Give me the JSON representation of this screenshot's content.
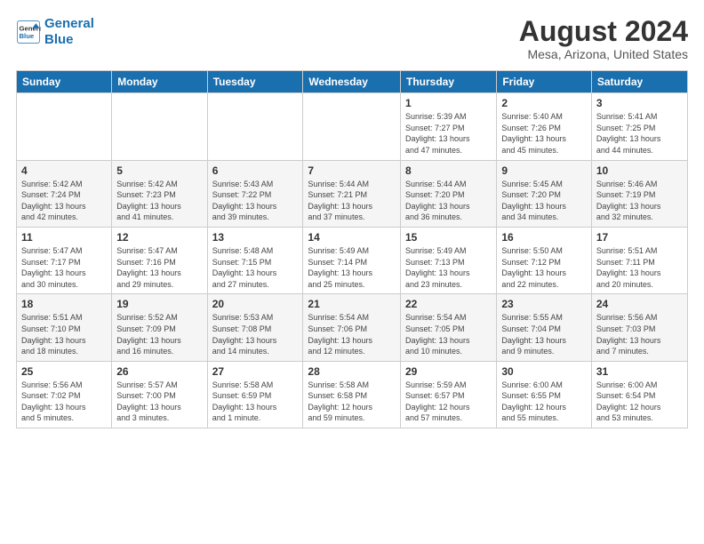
{
  "logo": {
    "line1": "General",
    "line2": "Blue"
  },
  "title": "August 2024",
  "subtitle": "Mesa, Arizona, United States",
  "days_header": [
    "Sunday",
    "Monday",
    "Tuesday",
    "Wednesday",
    "Thursday",
    "Friday",
    "Saturday"
  ],
  "weeks": [
    [
      {
        "day": "",
        "info": ""
      },
      {
        "day": "",
        "info": ""
      },
      {
        "day": "",
        "info": ""
      },
      {
        "day": "",
        "info": ""
      },
      {
        "day": "1",
        "info": "Sunrise: 5:39 AM\nSunset: 7:27 PM\nDaylight: 13 hours\nand 47 minutes."
      },
      {
        "day": "2",
        "info": "Sunrise: 5:40 AM\nSunset: 7:26 PM\nDaylight: 13 hours\nand 45 minutes."
      },
      {
        "day": "3",
        "info": "Sunrise: 5:41 AM\nSunset: 7:25 PM\nDaylight: 13 hours\nand 44 minutes."
      }
    ],
    [
      {
        "day": "4",
        "info": "Sunrise: 5:42 AM\nSunset: 7:24 PM\nDaylight: 13 hours\nand 42 minutes."
      },
      {
        "day": "5",
        "info": "Sunrise: 5:42 AM\nSunset: 7:23 PM\nDaylight: 13 hours\nand 41 minutes."
      },
      {
        "day": "6",
        "info": "Sunrise: 5:43 AM\nSunset: 7:22 PM\nDaylight: 13 hours\nand 39 minutes."
      },
      {
        "day": "7",
        "info": "Sunrise: 5:44 AM\nSunset: 7:21 PM\nDaylight: 13 hours\nand 37 minutes."
      },
      {
        "day": "8",
        "info": "Sunrise: 5:44 AM\nSunset: 7:20 PM\nDaylight: 13 hours\nand 36 minutes."
      },
      {
        "day": "9",
        "info": "Sunrise: 5:45 AM\nSunset: 7:20 PM\nDaylight: 13 hours\nand 34 minutes."
      },
      {
        "day": "10",
        "info": "Sunrise: 5:46 AM\nSunset: 7:19 PM\nDaylight: 13 hours\nand 32 minutes."
      }
    ],
    [
      {
        "day": "11",
        "info": "Sunrise: 5:47 AM\nSunset: 7:17 PM\nDaylight: 13 hours\nand 30 minutes."
      },
      {
        "day": "12",
        "info": "Sunrise: 5:47 AM\nSunset: 7:16 PM\nDaylight: 13 hours\nand 29 minutes."
      },
      {
        "day": "13",
        "info": "Sunrise: 5:48 AM\nSunset: 7:15 PM\nDaylight: 13 hours\nand 27 minutes."
      },
      {
        "day": "14",
        "info": "Sunrise: 5:49 AM\nSunset: 7:14 PM\nDaylight: 13 hours\nand 25 minutes."
      },
      {
        "day": "15",
        "info": "Sunrise: 5:49 AM\nSunset: 7:13 PM\nDaylight: 13 hours\nand 23 minutes."
      },
      {
        "day": "16",
        "info": "Sunrise: 5:50 AM\nSunset: 7:12 PM\nDaylight: 13 hours\nand 22 minutes."
      },
      {
        "day": "17",
        "info": "Sunrise: 5:51 AM\nSunset: 7:11 PM\nDaylight: 13 hours\nand 20 minutes."
      }
    ],
    [
      {
        "day": "18",
        "info": "Sunrise: 5:51 AM\nSunset: 7:10 PM\nDaylight: 13 hours\nand 18 minutes."
      },
      {
        "day": "19",
        "info": "Sunrise: 5:52 AM\nSunset: 7:09 PM\nDaylight: 13 hours\nand 16 minutes."
      },
      {
        "day": "20",
        "info": "Sunrise: 5:53 AM\nSunset: 7:08 PM\nDaylight: 13 hours\nand 14 minutes."
      },
      {
        "day": "21",
        "info": "Sunrise: 5:54 AM\nSunset: 7:06 PM\nDaylight: 13 hours\nand 12 minutes."
      },
      {
        "day": "22",
        "info": "Sunrise: 5:54 AM\nSunset: 7:05 PM\nDaylight: 13 hours\nand 10 minutes."
      },
      {
        "day": "23",
        "info": "Sunrise: 5:55 AM\nSunset: 7:04 PM\nDaylight: 13 hours\nand 9 minutes."
      },
      {
        "day": "24",
        "info": "Sunrise: 5:56 AM\nSunset: 7:03 PM\nDaylight: 13 hours\nand 7 minutes."
      }
    ],
    [
      {
        "day": "25",
        "info": "Sunrise: 5:56 AM\nSunset: 7:02 PM\nDaylight: 13 hours\nand 5 minutes."
      },
      {
        "day": "26",
        "info": "Sunrise: 5:57 AM\nSunset: 7:00 PM\nDaylight: 13 hours\nand 3 minutes."
      },
      {
        "day": "27",
        "info": "Sunrise: 5:58 AM\nSunset: 6:59 PM\nDaylight: 13 hours\nand 1 minute."
      },
      {
        "day": "28",
        "info": "Sunrise: 5:58 AM\nSunset: 6:58 PM\nDaylight: 12 hours\nand 59 minutes."
      },
      {
        "day": "29",
        "info": "Sunrise: 5:59 AM\nSunset: 6:57 PM\nDaylight: 12 hours\nand 57 minutes."
      },
      {
        "day": "30",
        "info": "Sunrise: 6:00 AM\nSunset: 6:55 PM\nDaylight: 12 hours\nand 55 minutes."
      },
      {
        "day": "31",
        "info": "Sunrise: 6:00 AM\nSunset: 6:54 PM\nDaylight: 12 hours\nand 53 minutes."
      }
    ]
  ]
}
